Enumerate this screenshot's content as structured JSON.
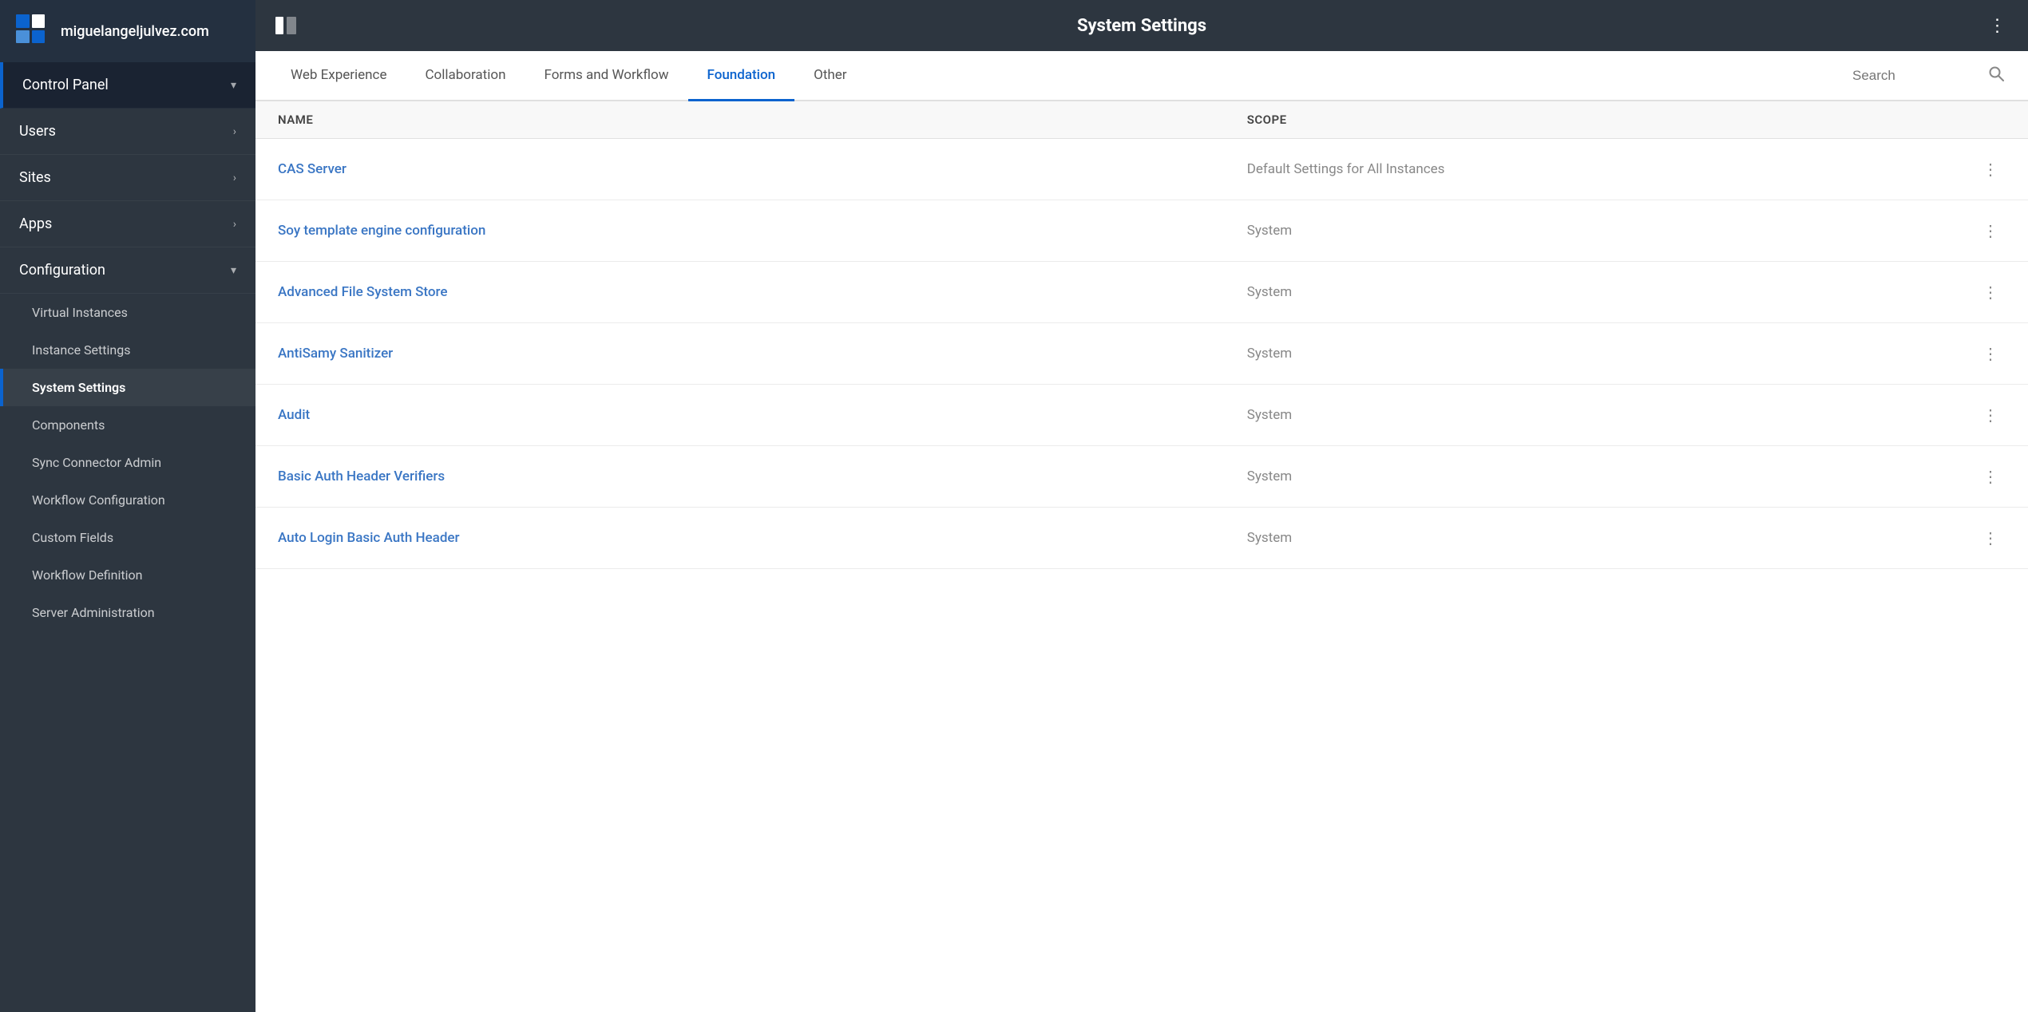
{
  "sidebar": {
    "site_name": "miguelangeljulvez.com",
    "nav_items": [
      {
        "id": "control-panel",
        "label": "Control Panel",
        "has_chevron": true,
        "chevron": "▾",
        "active": true
      },
      {
        "id": "users",
        "label": "Users",
        "has_chevron": true,
        "chevron": "›"
      },
      {
        "id": "sites",
        "label": "Sites",
        "has_chevron": true,
        "chevron": "›"
      },
      {
        "id": "apps",
        "label": "Apps",
        "has_chevron": true,
        "chevron": "›"
      },
      {
        "id": "configuration",
        "label": "Configuration",
        "has_chevron": true,
        "chevron": "▾"
      }
    ],
    "sub_items": [
      {
        "id": "virtual-instances",
        "label": "Virtual Instances"
      },
      {
        "id": "instance-settings",
        "label": "Instance Settings"
      },
      {
        "id": "system-settings",
        "label": "System Settings",
        "active": true
      },
      {
        "id": "components",
        "label": "Components"
      },
      {
        "id": "sync-connector-admin",
        "label": "Sync Connector Admin"
      },
      {
        "id": "workflow-configuration",
        "label": "Workflow Configuration"
      },
      {
        "id": "custom-fields",
        "label": "Custom Fields"
      },
      {
        "id": "workflow-definition",
        "label": "Workflow Definition"
      },
      {
        "id": "server-administration",
        "label": "Server Administration"
      }
    ]
  },
  "topbar": {
    "title": "System Settings",
    "toggle_icon": "▬",
    "more_icon": "⋮"
  },
  "tabs": {
    "items": [
      {
        "id": "web-experience",
        "label": "Web Experience"
      },
      {
        "id": "collaboration",
        "label": "Collaboration"
      },
      {
        "id": "forms-and-workflow",
        "label": "Forms and Workflow"
      },
      {
        "id": "foundation",
        "label": "Foundation",
        "active": true
      },
      {
        "id": "other",
        "label": "Other"
      }
    ],
    "search_placeholder": "Search"
  },
  "table": {
    "columns": {
      "name": "Name",
      "scope": "Scope"
    },
    "rows": [
      {
        "id": "cas-server",
        "name": "CAS Server",
        "scope": "Default Settings for All Instances"
      },
      {
        "id": "soy-template",
        "name": "Soy template engine configuration",
        "scope": "System"
      },
      {
        "id": "advanced-file",
        "name": "Advanced File System Store",
        "scope": "System"
      },
      {
        "id": "antisamy",
        "name": "AntiSamy Sanitizer",
        "scope": "System"
      },
      {
        "id": "audit",
        "name": "Audit",
        "scope": "System"
      },
      {
        "id": "basic-auth",
        "name": "Basic Auth Header Verifiers",
        "scope": "System"
      },
      {
        "id": "auto-login",
        "name": "Auto Login Basic Auth Header",
        "scope": "System"
      }
    ]
  }
}
